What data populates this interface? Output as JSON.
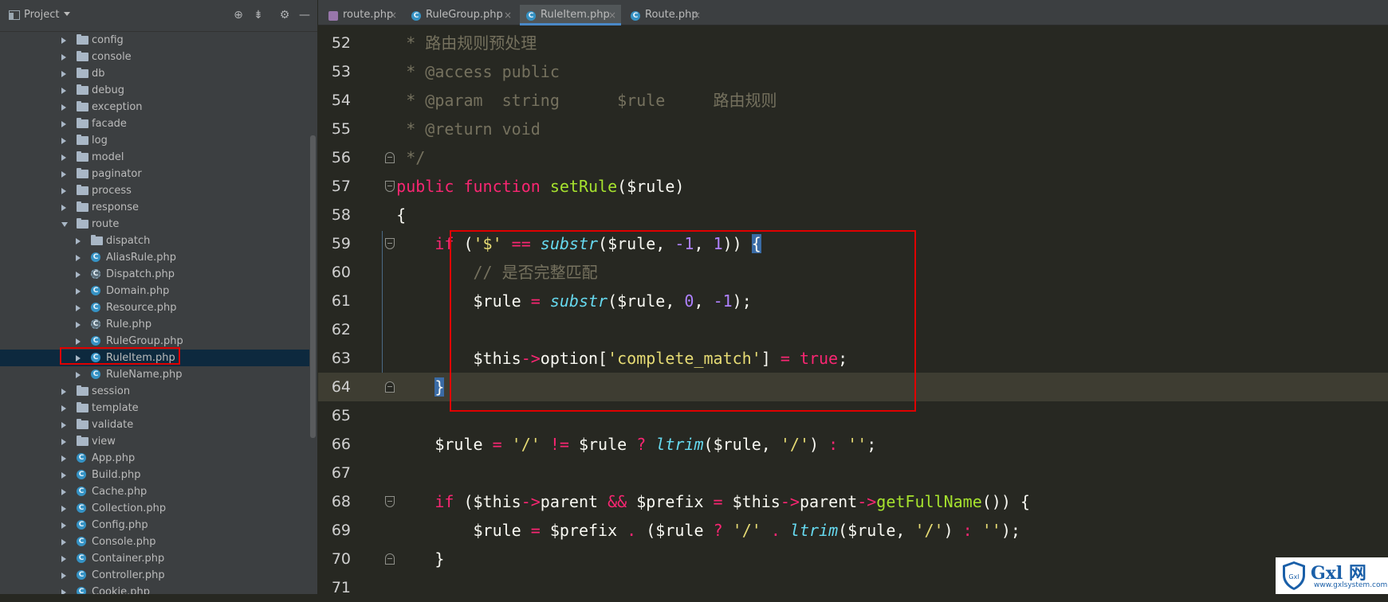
{
  "sidebar": {
    "title": "Project",
    "tools": [
      "target-icon",
      "collapse-icon",
      "gear-icon",
      "minimize-icon"
    ],
    "tree": [
      {
        "type": "folder",
        "label": "config",
        "depth": 1
      },
      {
        "type": "folder",
        "label": "console",
        "depth": 1
      },
      {
        "type": "folder",
        "label": "db",
        "depth": 1
      },
      {
        "type": "folder",
        "label": "debug",
        "depth": 1
      },
      {
        "type": "folder",
        "label": "exception",
        "depth": 1
      },
      {
        "type": "folder",
        "label": "facade",
        "depth": 1
      },
      {
        "type": "folder",
        "label": "log",
        "depth": 1
      },
      {
        "type": "folder",
        "label": "model",
        "depth": 1
      },
      {
        "type": "folder",
        "label": "paginator",
        "depth": 1
      },
      {
        "type": "folder",
        "label": "process",
        "depth": 1
      },
      {
        "type": "folder",
        "label": "response",
        "depth": 1
      },
      {
        "type": "folder",
        "label": "route",
        "depth": 1,
        "open": true
      },
      {
        "type": "folder",
        "label": "dispatch",
        "depth": 2
      },
      {
        "type": "class",
        "label": "AliasRule.php",
        "depth": 2
      },
      {
        "type": "abstract",
        "label": "Dispatch.php",
        "depth": 2
      },
      {
        "type": "class",
        "label": "Domain.php",
        "depth": 2
      },
      {
        "type": "class",
        "label": "Resource.php",
        "depth": 2
      },
      {
        "type": "abstract",
        "label": "Rule.php",
        "depth": 2
      },
      {
        "type": "class",
        "label": "RuleGroup.php",
        "depth": 2
      },
      {
        "type": "class",
        "label": "RuleItem.php",
        "depth": 2,
        "selected": true
      },
      {
        "type": "class",
        "label": "RuleName.php",
        "depth": 2
      },
      {
        "type": "folder",
        "label": "session",
        "depth": 1
      },
      {
        "type": "folder",
        "label": "template",
        "depth": 1
      },
      {
        "type": "folder",
        "label": "validate",
        "depth": 1
      },
      {
        "type": "folder",
        "label": "view",
        "depth": 1
      },
      {
        "type": "class",
        "label": "App.php",
        "depth": 1
      },
      {
        "type": "class",
        "label": "Build.php",
        "depth": 1
      },
      {
        "type": "class",
        "label": "Cache.php",
        "depth": 1
      },
      {
        "type": "class",
        "label": "Collection.php",
        "depth": 1
      },
      {
        "type": "class",
        "label": "Config.php",
        "depth": 1
      },
      {
        "type": "class",
        "label": "Console.php",
        "depth": 1
      },
      {
        "type": "class",
        "label": "Container.php",
        "depth": 1
      },
      {
        "type": "class",
        "label": "Controller.php",
        "depth": 1
      },
      {
        "type": "class",
        "label": "Cookie.php",
        "depth": 1
      }
    ]
  },
  "tabs": [
    {
      "label": "route.php",
      "icon": "file",
      "active": false
    },
    {
      "label": "RuleGroup.php",
      "icon": "class",
      "active": false
    },
    {
      "label": "RuleItem.php",
      "icon": "class",
      "active": true
    },
    {
      "label": "Route.php",
      "icon": "class",
      "active": false
    }
  ],
  "tab_close_glyph": "×",
  "class_icon_glyph": "C",
  "code": {
    "current_line": 64,
    "lines": [
      {
        "n": "52",
        "fold": "",
        "tokens": [
          [
            "c-com",
            "     * 路由规则预处理"
          ]
        ]
      },
      {
        "n": "53",
        "fold": "",
        "tokens": [
          [
            "c-com",
            "     * @access public"
          ]
        ]
      },
      {
        "n": "54",
        "fold": "",
        "tokens": [
          [
            "c-com",
            "     * @param  string      $rule     路由规则"
          ]
        ]
      },
      {
        "n": "55",
        "fold": "",
        "tokens": [
          [
            "c-com",
            "     * @return void"
          ]
        ]
      },
      {
        "n": "56",
        "fold": "up",
        "tokens": [
          [
            "c-com",
            "     */"
          ]
        ]
      },
      {
        "n": "57",
        "fold": "down",
        "tokens": [
          [
            "c-kw",
            "    public "
          ],
          [
            "c-kw",
            "function "
          ],
          [
            "c-fn",
            "setRule"
          ],
          [
            "c-var",
            "($rule)"
          ]
        ]
      },
      {
        "n": "58",
        "fold": "",
        "tokens": [
          [
            "c-var",
            "    {"
          ]
        ]
      },
      {
        "n": "59",
        "fold": "down",
        "tokens": [
          [
            "c-kw",
            "        if "
          ],
          [
            "c-var",
            "("
          ],
          [
            "c-str",
            "'$'"
          ],
          [
            "c-kw",
            " == "
          ],
          [
            "c-bi",
            "substr"
          ],
          [
            "c-var",
            "($rule, "
          ],
          [
            "c-num",
            "-1"
          ],
          [
            "c-var",
            ", "
          ],
          [
            "c-num",
            "1"
          ],
          [
            "c-var",
            ")) "
          ],
          [
            "c-brk",
            "{"
          ]
        ]
      },
      {
        "n": "60",
        "fold": "",
        "tokens": [
          [
            "c-com",
            "            // 是否完整匹配"
          ]
        ]
      },
      {
        "n": "61",
        "fold": "",
        "tokens": [
          [
            "c-var",
            "            $rule "
          ],
          [
            "c-kw",
            "= "
          ],
          [
            "c-bi",
            "substr"
          ],
          [
            "c-var",
            "($rule, "
          ],
          [
            "c-num",
            "0"
          ],
          [
            "c-var",
            ", "
          ],
          [
            "c-num",
            "-1"
          ],
          [
            "c-var",
            ");"
          ]
        ]
      },
      {
        "n": "62",
        "fold": "",
        "tokens": [
          [
            "c-var",
            ""
          ]
        ]
      },
      {
        "n": "63",
        "fold": "",
        "tokens": [
          [
            "c-var",
            "            $this"
          ],
          [
            "c-kw",
            "->"
          ],
          [
            "c-var",
            "option["
          ],
          [
            "c-str",
            "'complete_match'"
          ],
          [
            "c-var",
            "] "
          ],
          [
            "c-kw",
            "= "
          ],
          [
            "c-kw",
            "true"
          ],
          [
            "c-var",
            ";"
          ]
        ]
      },
      {
        "n": "64",
        "fold": "up",
        "tokens": [
          [
            "c-var",
            "        "
          ],
          [
            "c-brk",
            "}"
          ]
        ]
      },
      {
        "n": "65",
        "fold": "",
        "tokens": [
          [
            "c-var",
            ""
          ]
        ]
      },
      {
        "n": "66",
        "fold": "",
        "tokens": [
          [
            "c-var",
            "        $rule "
          ],
          [
            "c-kw",
            "= "
          ],
          [
            "c-str",
            "'/'"
          ],
          [
            "c-kw",
            " != "
          ],
          [
            "c-var",
            "$rule "
          ],
          [
            "c-kw",
            "? "
          ],
          [
            "c-bi",
            "ltrim"
          ],
          [
            "c-var",
            "($rule, "
          ],
          [
            "c-str",
            "'/'"
          ],
          [
            "c-var",
            ") "
          ],
          [
            "c-kw",
            ": "
          ],
          [
            "c-str",
            "''"
          ],
          [
            "c-var",
            ";"
          ]
        ]
      },
      {
        "n": "67",
        "fold": "",
        "tokens": [
          [
            "c-var",
            ""
          ]
        ]
      },
      {
        "n": "68",
        "fold": "down",
        "tokens": [
          [
            "c-kw",
            "        if "
          ],
          [
            "c-var",
            "($this"
          ],
          [
            "c-kw",
            "->"
          ],
          [
            "c-var",
            "parent "
          ],
          [
            "c-kw",
            "&& "
          ],
          [
            "c-var",
            "$prefix "
          ],
          [
            "c-kw",
            "= "
          ],
          [
            "c-var",
            "$this"
          ],
          [
            "c-kw",
            "->"
          ],
          [
            "c-var",
            "parent"
          ],
          [
            "c-kw",
            "->"
          ],
          [
            "c-fn",
            "getFullName"
          ],
          [
            "c-var",
            "()) {"
          ]
        ]
      },
      {
        "n": "69",
        "fold": "",
        "tokens": [
          [
            "c-var",
            "            $rule "
          ],
          [
            "c-kw",
            "= "
          ],
          [
            "c-var",
            "$prefix "
          ],
          [
            "c-kw",
            ". "
          ],
          [
            "c-var",
            "($rule "
          ],
          [
            "c-kw",
            "? "
          ],
          [
            "c-str",
            "'/'"
          ],
          [
            "c-kw",
            " . "
          ],
          [
            "c-bi",
            "ltrim"
          ],
          [
            "c-var",
            "($rule, "
          ],
          [
            "c-str",
            "'/'"
          ],
          [
            "c-var",
            ") "
          ],
          [
            "c-kw",
            ": "
          ],
          [
            "c-str",
            "''"
          ],
          [
            "c-var",
            ");"
          ]
        ]
      },
      {
        "n": "70",
        "fold": "up",
        "tokens": [
          [
            "c-var",
            "        }"
          ]
        ]
      },
      {
        "n": "71",
        "fold": "",
        "tokens": [
          [
            "c-var",
            ""
          ]
        ]
      }
    ]
  },
  "watermark": {
    "text": "Gxl 网",
    "url": "www.gxlsystem.com",
    "shield": "Gxl"
  }
}
